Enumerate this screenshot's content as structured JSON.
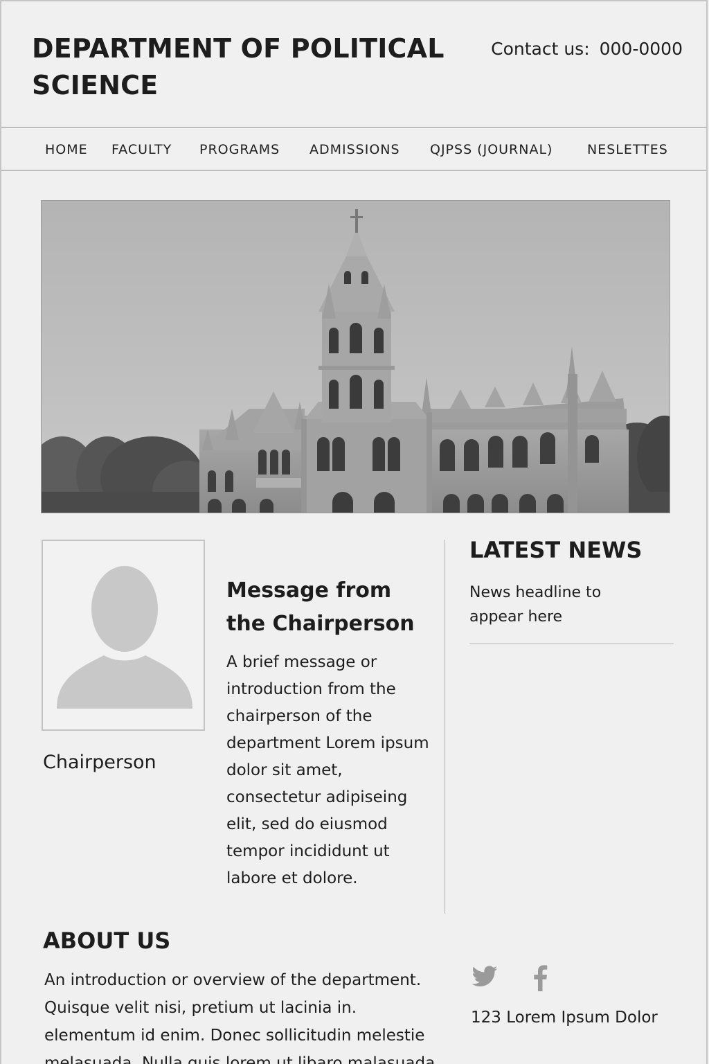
{
  "header": {
    "title": "DEPARTMENT OF POLITICAL SCIENCE",
    "contact_label": "Contact us:",
    "contact_number": "000-0000"
  },
  "nav": {
    "items": [
      {
        "label": "HOME"
      },
      {
        "label": "FACULTY"
      },
      {
        "label": "PROGRAMS"
      },
      {
        "label": "ADMISSIONS"
      },
      {
        "label": "QJPSS (JOURNAL)"
      },
      {
        "label": "NESLETTES"
      }
    ]
  },
  "hero": {
    "image": "campus-building-photo"
  },
  "chairperson": {
    "avatar": "person-placeholder-icon",
    "label": "Chairperson",
    "message_title": "Message from the Chairperson",
    "message_body": "A brief message or introduction from the chairperson of the department Lorem ipsum dolor sit amet, consectetur adipiseing elit, sed do eiusmod tempor incididunt ut labore et dolore."
  },
  "news": {
    "title": "LATEST NEWS",
    "items": [
      {
        "headline": "News headline to appear here"
      }
    ]
  },
  "about": {
    "title": "ABOUT US",
    "body": "An introduction or overview of the department. Quisque velit nisi, pretium ut lacinia in. elementum id enim. Donec sollicitudin melestie melasuada. Nulla quis lorem ut libaro malasuada"
  },
  "footer": {
    "social": [
      "twitter-icon",
      "facebook-icon"
    ],
    "address": "123 Lorem Ipsum Dolor"
  },
  "colors": {
    "background": "#f0f0f0",
    "text": "#1d1d1d",
    "divider": "#bdbdbd",
    "placeholder": "#c8c8c8"
  }
}
